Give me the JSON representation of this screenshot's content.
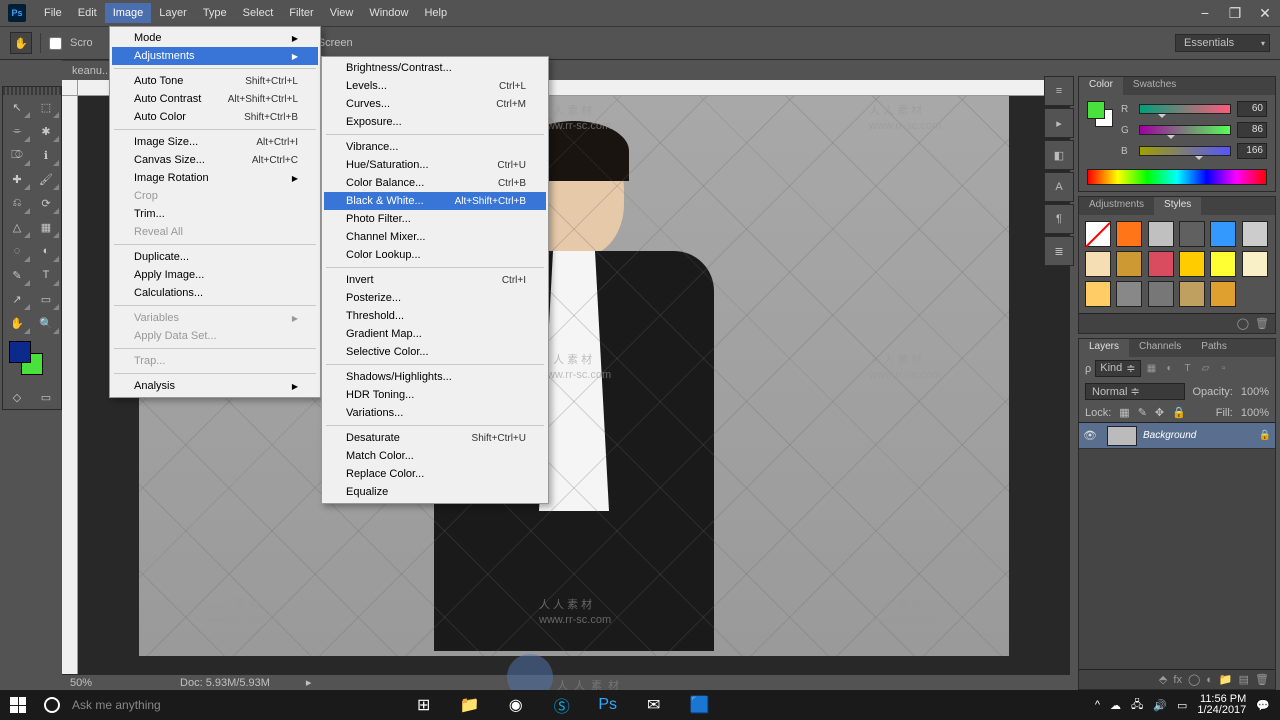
{
  "menubar": {
    "items": [
      "File",
      "Edit",
      "Image",
      "Layer",
      "Type",
      "Select",
      "Filter",
      "View",
      "Window",
      "Help"
    ],
    "open_index": 2
  },
  "window_controls": {
    "min": "−",
    "max": "❐",
    "close": "✕"
  },
  "options_bar": {
    "scroll_label": "Scro",
    "fit_label": "Fill Screen",
    "workspace": "Essentials"
  },
  "doc_tab": {
    "label": "keanu..."
  },
  "image_menu": [
    {
      "label": "Mode",
      "arrow": true
    },
    {
      "label": "Adjustments",
      "arrow": true,
      "highlight": true
    },
    {
      "sep": true
    },
    {
      "label": "Auto Tone",
      "shortcut": "Shift+Ctrl+L"
    },
    {
      "label": "Auto Contrast",
      "shortcut": "Alt+Shift+Ctrl+L"
    },
    {
      "label": "Auto Color",
      "shortcut": "Shift+Ctrl+B"
    },
    {
      "sep": true
    },
    {
      "label": "Image Size...",
      "shortcut": "Alt+Ctrl+I"
    },
    {
      "label": "Canvas Size...",
      "shortcut": "Alt+Ctrl+C"
    },
    {
      "label": "Image Rotation",
      "arrow": true
    },
    {
      "label": "Crop",
      "disabled": true
    },
    {
      "label": "Trim..."
    },
    {
      "label": "Reveal All",
      "disabled": true
    },
    {
      "sep": true
    },
    {
      "label": "Duplicate..."
    },
    {
      "label": "Apply Image..."
    },
    {
      "label": "Calculations..."
    },
    {
      "sep": true
    },
    {
      "label": "Variables",
      "arrow": true,
      "disabled": true
    },
    {
      "label": "Apply Data Set...",
      "disabled": true
    },
    {
      "sep": true
    },
    {
      "label": "Trap...",
      "disabled": true
    },
    {
      "sep": true
    },
    {
      "label": "Analysis",
      "arrow": true
    }
  ],
  "adjustments_menu": [
    {
      "label": "Brightness/Contrast..."
    },
    {
      "label": "Levels...",
      "shortcut": "Ctrl+L"
    },
    {
      "label": "Curves...",
      "shortcut": "Ctrl+M"
    },
    {
      "label": "Exposure..."
    },
    {
      "sep": true
    },
    {
      "label": "Vibrance..."
    },
    {
      "label": "Hue/Saturation...",
      "shortcut": "Ctrl+U"
    },
    {
      "label": "Color Balance...",
      "shortcut": "Ctrl+B"
    },
    {
      "label": "Black & White...",
      "shortcut": "Alt+Shift+Ctrl+B",
      "highlight": true
    },
    {
      "label": "Photo Filter..."
    },
    {
      "label": "Channel Mixer..."
    },
    {
      "label": "Color Lookup..."
    },
    {
      "sep": true
    },
    {
      "label": "Invert",
      "shortcut": "Ctrl+I"
    },
    {
      "label": "Posterize..."
    },
    {
      "label": "Threshold..."
    },
    {
      "label": "Gradient Map..."
    },
    {
      "label": "Selective Color..."
    },
    {
      "sep": true
    },
    {
      "label": "Shadows/Highlights..."
    },
    {
      "label": "HDR Toning..."
    },
    {
      "label": "Variations..."
    },
    {
      "sep": true
    },
    {
      "label": "Desaturate",
      "shortcut": "Shift+Ctrl+U"
    },
    {
      "label": "Match Color..."
    },
    {
      "label": "Replace Color..."
    },
    {
      "label": "Equalize"
    }
  ],
  "status": {
    "zoom": "50%",
    "doc": "Doc: 5.93M/5.93M"
  },
  "color_panel": {
    "tabs": [
      "Color",
      "Swatches"
    ],
    "r": 60,
    "g": 86,
    "b": 166
  },
  "adjustments_panel": {
    "tabs": [
      "Adjustments",
      "Styles"
    ]
  },
  "layers_panel": {
    "tabs": [
      "Layers",
      "Channels",
      "Paths"
    ],
    "kind": "Kind",
    "blend": "Normal",
    "opacity_label": "Opacity:",
    "opacity": "100%",
    "lock_label": "Lock:",
    "fill_label": "Fill:",
    "fill": "100%",
    "layer_name": "Background"
  },
  "watermark": {
    "cn": "人 人 素 材",
    "url": "www.rr-sc.com",
    "big": "人人素材"
  },
  "taskbar": {
    "search": "Ask me anything",
    "time": "11:56 PM",
    "date": "1/24/2017"
  },
  "styles_colors": [
    "#ffffff",
    "#ff7518",
    "#c0c0c0",
    "#606060",
    "#3399ff",
    "#cccccc",
    "#f5deb3",
    "#cc9933",
    "#d94b5e",
    "#ffcc00",
    "#ffff33",
    "#faf0c8",
    "#ffcc66",
    "#888888",
    "#777777",
    "#c0a060",
    "#e0a030"
  ]
}
